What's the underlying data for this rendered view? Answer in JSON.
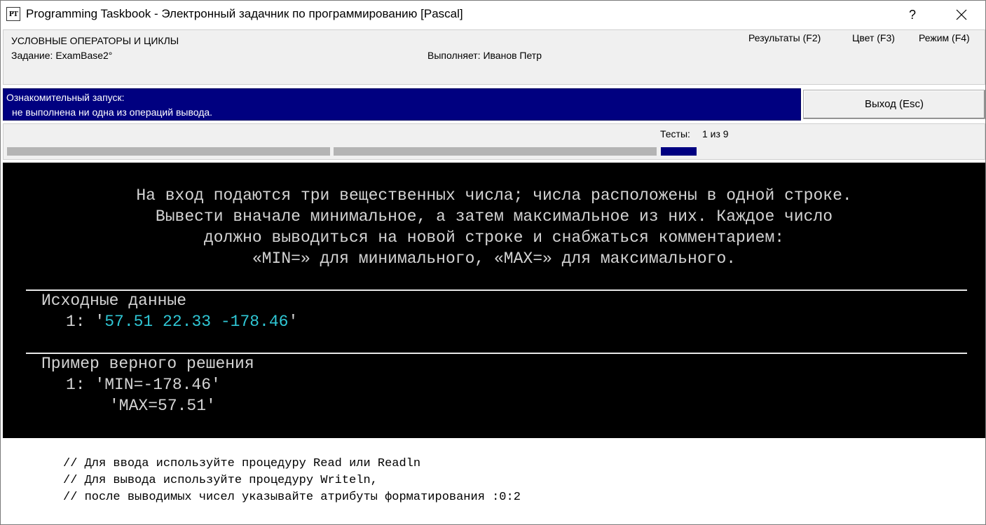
{
  "window": {
    "icon_text": "PT",
    "title": "Programming Taskbook - Электронный задачник по программированию [Pascal]",
    "help_label": "?"
  },
  "header": {
    "section": "УСЛОВНЫЕ ОПЕРАТОРЫ И ЦИКЛЫ",
    "task": "Задание: ExamBase2°",
    "performer": "Выполняет: Иванов Петр",
    "menu": {
      "results": "Результаты (F2)",
      "color": "Цвет (F3)",
      "mode": "Режим (F4)"
    }
  },
  "status": {
    "line1": "Ознакомительный запуск:",
    "line2": "не выполнена ни одна из операций вывода."
  },
  "exit_button": {
    "label": "Выход (Esc)"
  },
  "tests": {
    "label": "Тесты:",
    "value": "1 из 9",
    "progress": {
      "current": 1,
      "total": 9
    }
  },
  "task_description": {
    "lines": [
      "На вход подаются три вещественных числа; числа расположены в одной строке.",
      "Вывести вначале минимальное, а затем максимальное из них. Каждое число",
      "должно выводиться на новой строке и снабжаться комментарием:",
      "«MIN=» для минимального, «MAX=» для максимального."
    ]
  },
  "input_section": {
    "title": "Исходные данные",
    "line_prefix": "1: '",
    "value": "57.51 22.33 -178.46",
    "line_suffix": "'"
  },
  "example_section": {
    "title": "Пример верного решения",
    "line1": "1: 'MIN=-178.46'",
    "line2": "'MAX=57.51'"
  },
  "comments": [
    "// Для ввода используйте процедуру Read или Readln",
    "// Для вывода используйте процедуру Writeln,",
    "// после выводимых чисел указывайте атрибуты форматирования :0:2"
  ],
  "colors": {
    "status_bg": "#000080",
    "progress_done": "#000080",
    "progress_todo": "#b4b4b4",
    "console_bg": "#000000",
    "console_text": "#d4d4d4",
    "input_value": "#2fc6d4"
  }
}
